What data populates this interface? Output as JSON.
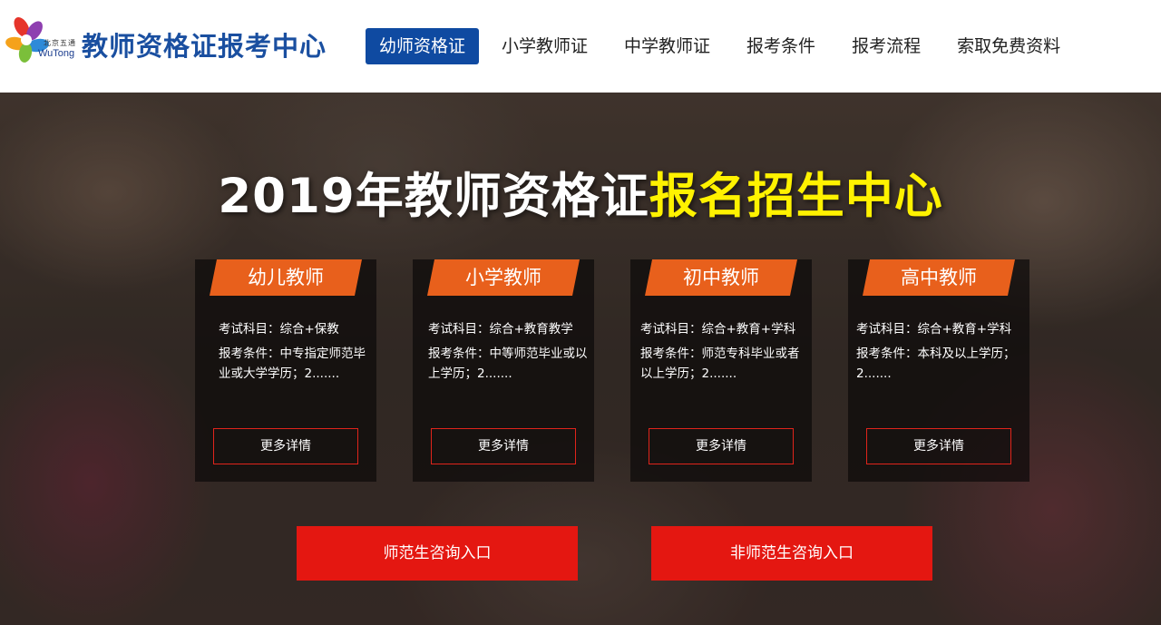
{
  "header": {
    "logo": {
      "cn_text": "北京五通",
      "en_text": "WuTong",
      "colors": [
        "#e6352b",
        "#f5a21b",
        "#7bbf3a",
        "#2e8ad8",
        "#8e3fb0"
      ]
    },
    "site_title": "教师资格证报考中心",
    "nav": [
      {
        "label": "幼师资格证",
        "active": true
      },
      {
        "label": "小学教师证"
      },
      {
        "label": "中学教师证"
      },
      {
        "label": "报考条件"
      },
      {
        "label": "报考流程"
      },
      {
        "label": "索取免费资料"
      }
    ],
    "accent": "#0f4aa1"
  },
  "hero": {
    "title_white": "2019年教师资格证",
    "title_highlight": "报名招生中心",
    "highlight_color": "#fff200",
    "cards": [
      {
        "title": "幼儿教师",
        "subjects": "考试科目：综合+保教",
        "conditions": "报考条件：中专指定师范毕业或大学学历；2.......",
        "button": "更多详情"
      },
      {
        "title": "小学教师",
        "subjects": "考试科目：综合+教育教学",
        "conditions": "报考条件：中等师范毕业或以上学历；2.......",
        "button": "更多详情"
      },
      {
        "title": "初中教师",
        "subjects": "考试科目：综合+教育+学科",
        "conditions": "报考条件：师范专科毕业或者以上学历；2.......",
        "button": "更多详情"
      },
      {
        "title": "高中教师",
        "subjects": "考试科目：综合+教育+学科",
        "conditions": "报考条件：本科及以上学历；2.......",
        "button": "更多详情"
      }
    ],
    "tab_color": "#e8601c",
    "cta_buttons": [
      {
        "label": "师范生咨询入口"
      },
      {
        "label": "非师范生咨询入口"
      }
    ],
    "cta_color": "#e41711"
  }
}
